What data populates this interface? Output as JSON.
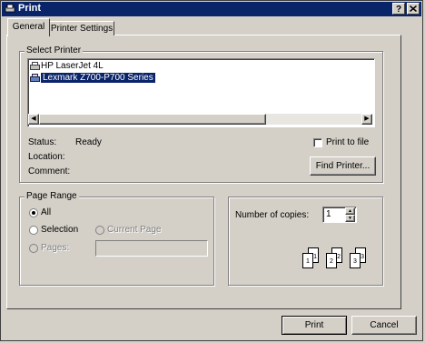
{
  "window": {
    "title": "Print",
    "help_label": "?",
    "close_label": "X"
  },
  "tabs": [
    {
      "label": "General"
    },
    {
      "label": "Printer Settings"
    }
  ],
  "select_printer": {
    "legend": "Select Printer",
    "printers": [
      {
        "name": "HP LaserJet 4L",
        "selected": false
      },
      {
        "name": "Lexmark Z700-P700 Series",
        "selected": true
      }
    ]
  },
  "status": {
    "status_label": "Status:",
    "status_value": "Ready",
    "location_label": "Location:",
    "location_value": "",
    "comment_label": "Comment:",
    "comment_value": ""
  },
  "print_to_file": {
    "label": "Print to file",
    "checked": false
  },
  "find_printer_button": "Find Printer...",
  "page_range": {
    "legend": "Page Range",
    "all_label": "All",
    "selection_label": "Selection",
    "current_page_label": "Current Page",
    "pages_label": "Pages:",
    "pages_value": ""
  },
  "copies": {
    "label": "Number of copies:",
    "value": "1",
    "collate_digits": [
      "1",
      "1",
      "2",
      "2",
      "3",
      "3"
    ]
  },
  "footer": {
    "print_label": "Print",
    "cancel_label": "Cancel"
  }
}
